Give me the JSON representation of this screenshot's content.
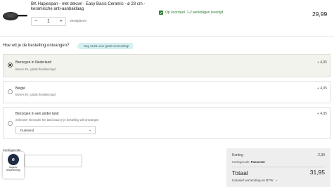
{
  "product": {
    "title": "BK Hapjespan - met deksel - Easy Basic Ceramic - ø 28 cm - keramische anti-aanbaklaag",
    "quantity": "1",
    "minus": "−",
    "plus": "+",
    "remove_label": "Verwijderen",
    "stock_text": "Op voorraad. 1-2 werkdagen levertijd",
    "price": "29,99"
  },
  "delivery": {
    "question": "Hoe wil je de bestelling ontvangen?",
    "free_shipping_badge": "Nog 19,01 voor gratis verzending!",
    "options": [
      {
        "title": "Bezorgen in Nederland",
        "subtitle": "Boven 49,- gratis thuisbezorgd",
        "price": "+ 4,95",
        "selected": true
      },
      {
        "title": "België",
        "subtitle": "Boven 59,- gratis thuisbezorgd",
        "price": "+ 4,95",
        "selected": false
      },
      {
        "title": "Bezorgen in een ander land",
        "subtitle": "Selecteer hieronder het land waar je je bestelling wilt ontvangen",
        "price": "+ 4,95",
        "selected": false,
        "country_select": "Duitsland"
      }
    ]
  },
  "discount": {
    "label": "Kortingscode"
  },
  "protection_badge": {
    "line1": "Kopers-",
    "line2": "bescherming"
  },
  "summary": {
    "korting_label": "Korting",
    "korting_value": "-2,99",
    "code_label": "Kortingscode:",
    "code_value": "Pannen10",
    "total_label": "Totaal",
    "total_value": "31,95",
    "incl_label": "Inclusief verzending en BTW"
  },
  "colors": {
    "stock_green": "#2e7d32",
    "badge_bg": "#d6efef",
    "selected_option_bg": "#f3f3ee",
    "summary_bg": "#eeeeee"
  }
}
